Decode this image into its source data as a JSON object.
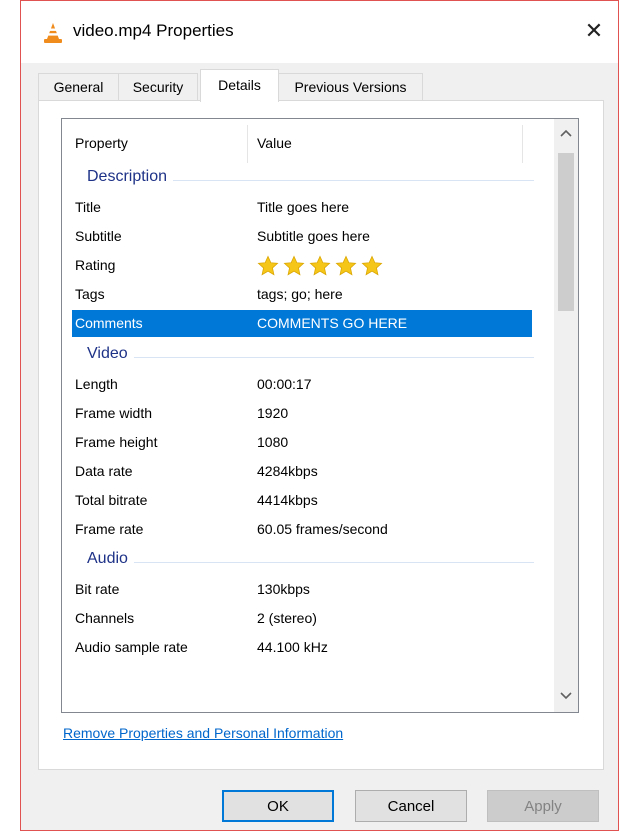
{
  "window": {
    "title": "video.mp4 Properties",
    "close_glyph": "✕"
  },
  "tabs": [
    {
      "label": "General",
      "active": false
    },
    {
      "label": "Security",
      "active": false
    },
    {
      "label": "Details",
      "active": true
    },
    {
      "label": "Previous Versions",
      "active": false
    }
  ],
  "details": {
    "col_property": "Property",
    "col_value": "Value",
    "groups": {
      "description": "Description",
      "video": "Video",
      "audio": "Audio"
    },
    "rows": {
      "title": {
        "k": "Title",
        "v": "Title goes here"
      },
      "subtitle": {
        "k": "Subtitle",
        "v": "Subtitle goes here"
      },
      "rating": {
        "k": "Rating",
        "stars": 5
      },
      "tags": {
        "k": "Tags",
        "v": "tags; go; here"
      },
      "comments": {
        "k": "Comments",
        "v": "COMMENTS GO HERE"
      },
      "length": {
        "k": "Length",
        "v": "00:00:17"
      },
      "frame_width": {
        "k": "Frame width",
        "v": "1920"
      },
      "frame_height": {
        "k": "Frame height",
        "v": "1080"
      },
      "data_rate": {
        "k": "Data rate",
        "v": "4284kbps"
      },
      "total_bitrate": {
        "k": "Total bitrate",
        "v": "4414kbps"
      },
      "frame_rate": {
        "k": "Frame rate",
        "v": "60.05 frames/second"
      },
      "bit_rate": {
        "k": "Bit rate",
        "v": "130kbps"
      },
      "channels": {
        "k": "Channels",
        "v": "2 (stereo)"
      },
      "sample_rate": {
        "k": "Audio sample rate",
        "v": "44.100 kHz"
      }
    },
    "selected_row": "comments"
  },
  "link": "Remove Properties and Personal Information",
  "buttons": {
    "ok": "OK",
    "cancel": "Cancel",
    "apply": "Apply"
  },
  "colors": {
    "selection": "#0078d7",
    "group_text": "#1e3287",
    "link": "#0066cc",
    "star": "#f5c518",
    "window_border": "#e05252"
  },
  "icons": [
    "vlc-cone-icon",
    "close-icon",
    "star-icon",
    "scroll-up-arrow-icon",
    "scroll-down-arrow-icon"
  ]
}
